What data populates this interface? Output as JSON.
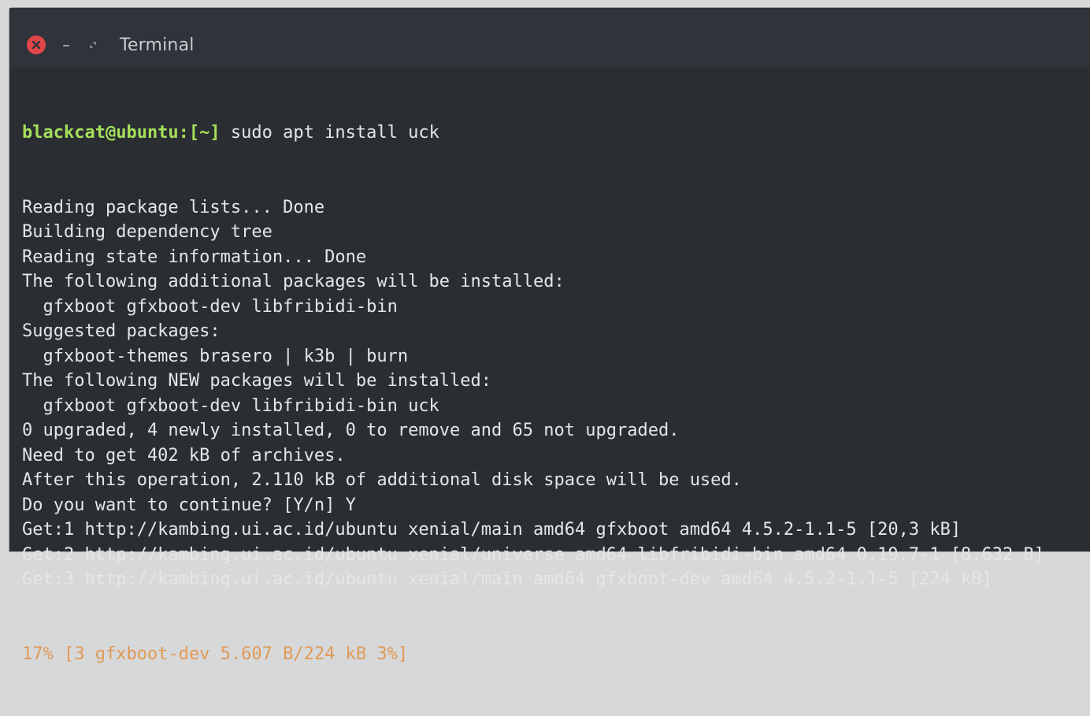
{
  "window": {
    "title": "Terminal",
    "close_icon": "close-icon",
    "minimize_icon": "minimize-icon",
    "maximize_icon": "maximize-icon",
    "colors": {
      "close": "#e0454a",
      "prompt": "#a5e05a",
      "progress": "#e19a55",
      "background": "#2a2e33"
    }
  },
  "terminal": {
    "prompt_user": "blackcat@ubuntu:",
    "prompt_path": "[~]",
    "command": " sudo apt install uck",
    "output_lines": [
      "Reading package lists... Done",
      "Building dependency tree",
      "Reading state information... Done",
      "The following additional packages will be installed:",
      "  gfxboot gfxboot-dev libfribidi-bin",
      "Suggested packages:",
      "  gfxboot-themes brasero | k3b | burn",
      "The following NEW packages will be installed:",
      "  gfxboot gfxboot-dev libfribidi-bin uck",
      "0 upgraded, 4 newly installed, 0 to remove and 65 not upgraded.",
      "Need to get 402 kB of archives.",
      "After this operation, 2.110 kB of additional disk space will be used.",
      "Do you want to continue? [Y/n] Y",
      "Get:1 http://kambing.ui.ac.id/ubuntu xenial/main amd64 gfxboot amd64 4.5.2-1.1-5 [20,3 kB]",
      "Get:2 http://kambing.ui.ac.id/ubuntu xenial/universe amd64 libfribidi-bin amd64 0.19.7-1 [8.632 B]",
      "Get:3 http://kambing.ui.ac.id/ubuntu xenial/main amd64 gfxboot-dev amd64 4.5.2-1.1-5 [224 kB]"
    ],
    "progress_line": "17% [3 gfxboot-dev 5.607 B/224 kB 3%]"
  }
}
